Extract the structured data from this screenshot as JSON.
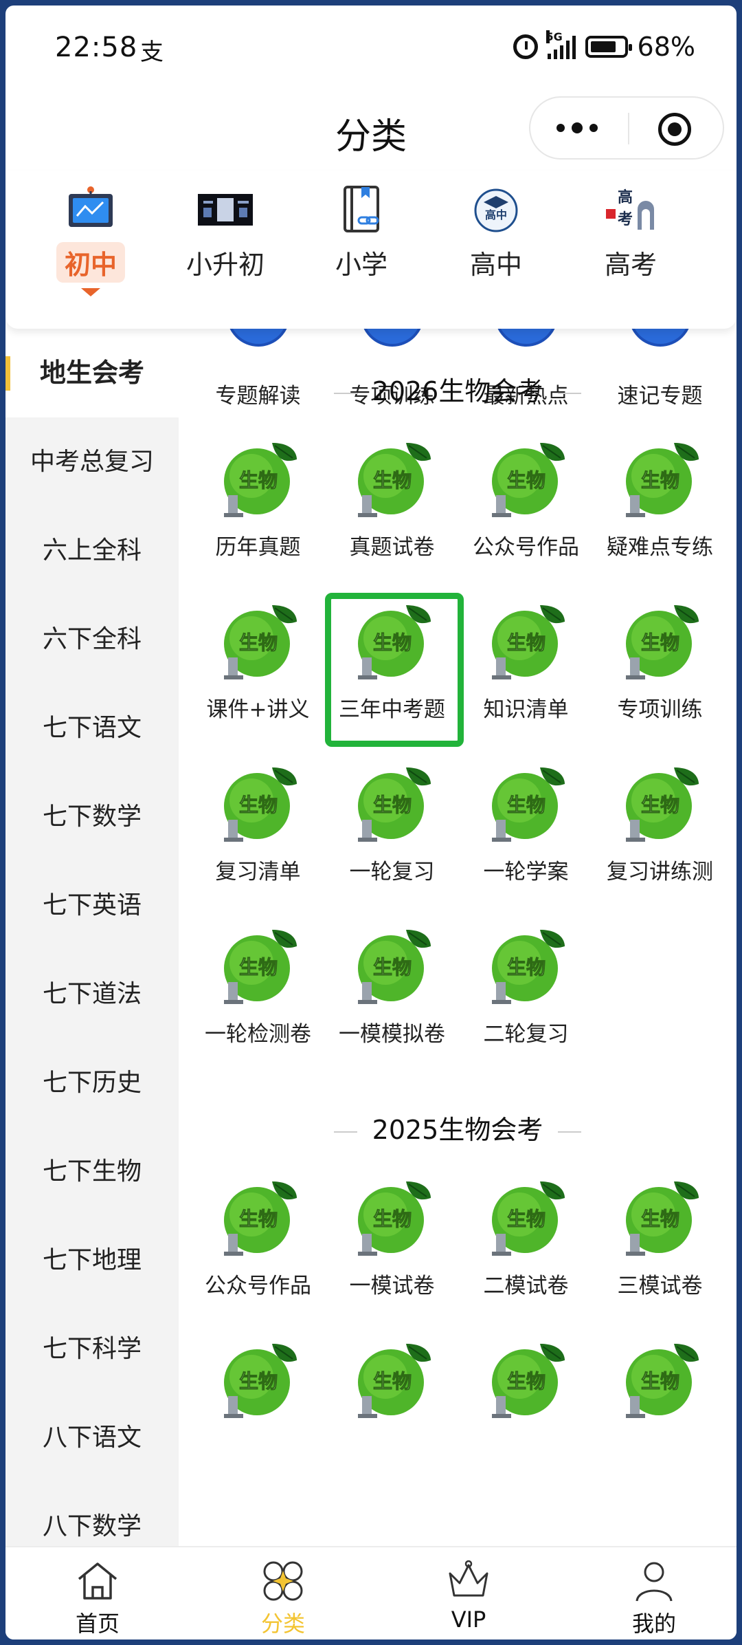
{
  "status_bar": {
    "time": "22:58",
    "extra_glyph": "支",
    "network": "5G",
    "battery": "68%"
  },
  "nav": {
    "title": "分类",
    "more_icon": "more-dots-icon",
    "close_icon": "target-close-icon"
  },
  "top_tabs": [
    {
      "label": "初中",
      "icon": "blackboard-icon",
      "active": true
    },
    {
      "label": "小升初",
      "icon": "banner-icon",
      "active": false
    },
    {
      "label": "小学",
      "icon": "book-link-icon",
      "active": false
    },
    {
      "label": "高中",
      "icon": "gaozhong-badge-icon",
      "active": false
    },
    {
      "label": "高考",
      "icon": "gaokao-badge-icon",
      "active": false
    }
  ],
  "tab_badge_text": {
    "gaozhong": "高中",
    "gaokao": "高考"
  },
  "sidebar": {
    "items": [
      "地生会考",
      "中考总复习",
      "六上全科",
      "六下全科",
      "七下语文",
      "七下数学",
      "七下英语",
      "七下道法",
      "七下历史",
      "七下生物",
      "七下地理",
      "七下科学",
      "八下语文",
      "八下数学"
    ],
    "active_index": 0
  },
  "content": {
    "top_row": [
      "专题解读",
      "专项训练",
      "最新热点",
      "速记专题"
    ],
    "sections": [
      {
        "title": "2026生物会考",
        "items": [
          "历年真题",
          "真题试卷",
          "公众号作品",
          "疑难点专练",
          "课件+讲义",
          "三年中考题",
          "知识清单",
          "专项训练",
          "复习清单",
          "一轮复习",
          "一轮学案",
          "复习讲练测",
          "一轮检测卷",
          "一模模拟卷",
          "二轮复习"
        ]
      },
      {
        "title": "2025生物会考",
        "items": [
          "公众号作品",
          "一模试卷",
          "二模试卷",
          "三模试卷",
          "",
          "",
          "",
          ""
        ]
      }
    ],
    "thumb_text": "生物",
    "highlighted_item": "三年中考题",
    "highlight_color": "#22b33a"
  },
  "tabbar": [
    {
      "label": "首页",
      "icon": "home-icon",
      "active": false
    },
    {
      "label": "分类",
      "icon": "category-icon",
      "active": true
    },
    {
      "label": "VIP",
      "icon": "crown-icon",
      "active": false
    },
    {
      "label": "我的",
      "icon": "user-icon",
      "active": false
    }
  ],
  "colors": {
    "accent_orange": "#e8642b",
    "active_yellow": "#f3c432",
    "sidebar_bg": "#f3f3f3",
    "frame": "#1d3f7a"
  }
}
